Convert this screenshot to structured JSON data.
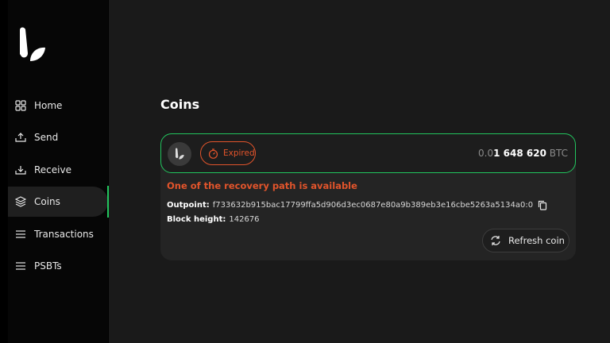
{
  "sidebar": {
    "items": [
      {
        "label": "Home",
        "icon": "grid-icon"
      },
      {
        "label": "Send",
        "icon": "send-icon"
      },
      {
        "label": "Receive",
        "icon": "receive-icon"
      },
      {
        "label": "Coins",
        "icon": "coins-icon",
        "active": true
      },
      {
        "label": "Transactions",
        "icon": "list-icon"
      },
      {
        "label": "PSBTs",
        "icon": "list-icon"
      }
    ]
  },
  "page": {
    "title": "Coins"
  },
  "coin": {
    "status": "Expired",
    "amount_dim": "0.0",
    "amount_bold": "1 648 620",
    "unit": "BTC",
    "warning": "One of the recovery path is available",
    "outpoint_label": "Outpoint:",
    "outpoint": "f733632b915bac17799ffa5d906d3ec0687e80a9b389eb3e16cbe5263a5134a0:0",
    "block_height_label": "Block height:",
    "block_height": "142676",
    "refresh_label": "Refresh coin"
  },
  "colors": {
    "accent": "#22c55e",
    "warning": "#e2542b",
    "background": "#1a1a1a",
    "sidebar": "#060606"
  }
}
